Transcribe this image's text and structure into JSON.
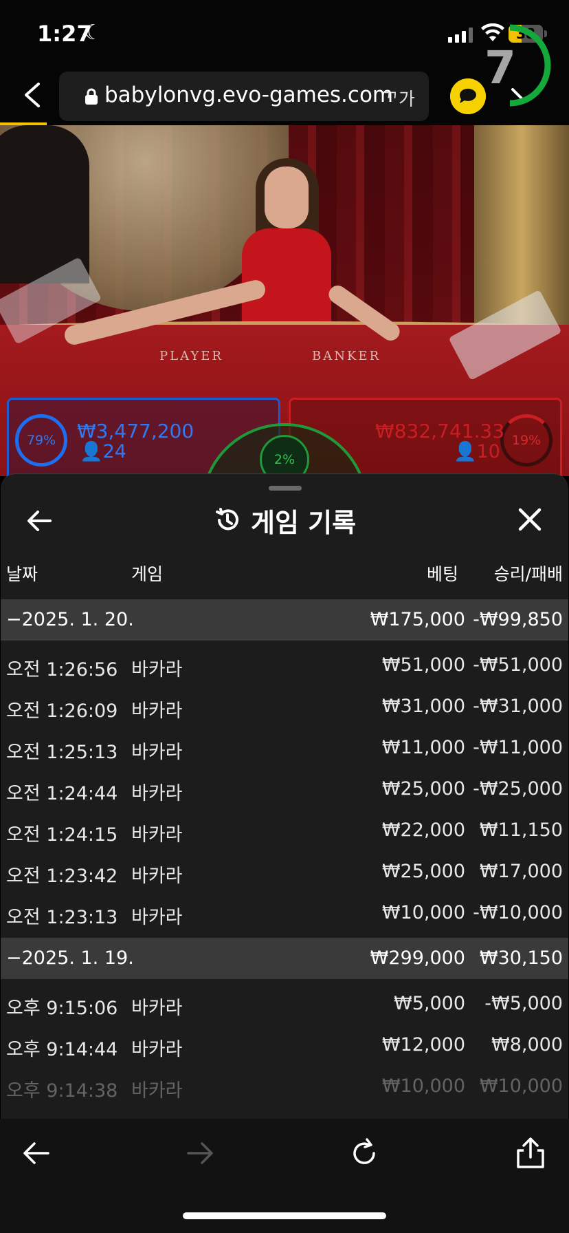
{
  "status_bar": {
    "time": "1:27",
    "moon_icon": "moon-icon",
    "battery": "38",
    "battery_color": "#f2c200"
  },
  "browser": {
    "url": "babylonvg.evo-games.com",
    "text_size_button": "ᄁ가",
    "accent_color": "#f2c200"
  },
  "game": {
    "timer": "7",
    "table_labels": {
      "player": "PLAYER",
      "banker": "BANKER"
    },
    "player": {
      "percent": "79%",
      "amount": "₩3,477,200",
      "count": "24",
      "color": "#2e7af5"
    },
    "banker": {
      "percent": "19%",
      "amount": "₩832,741.33",
      "count": "10",
      "color": "#c81e24"
    },
    "tie": {
      "percent": "2%",
      "color": "#2fc24f"
    }
  },
  "history": {
    "title": "게임 기록",
    "columns": {
      "date": "날짜",
      "game": "게임",
      "bet": "베팅",
      "result": "승리/패배"
    },
    "groups": [
      {
        "date": "−2025. 1. 20.",
        "bet": "₩175,000",
        "result": "-₩99,850",
        "rows": [
          {
            "time": "오전 1:26:56",
            "game": "바카라",
            "bet": "₩51,000",
            "result": "-₩51,000"
          },
          {
            "time": "오전 1:26:09",
            "game": "바카라",
            "bet": "₩31,000",
            "result": "-₩31,000"
          },
          {
            "time": "오전 1:25:13",
            "game": "바카라",
            "bet": "₩11,000",
            "result": "-₩11,000"
          },
          {
            "time": "오전 1:24:44",
            "game": "바카라",
            "bet": "₩25,000",
            "result": "-₩25,000"
          },
          {
            "time": "오전 1:24:15",
            "game": "바카라",
            "bet": "₩22,000",
            "result": "₩11,150"
          },
          {
            "time": "오전 1:23:42",
            "game": "바카라",
            "bet": "₩25,000",
            "result": "₩17,000"
          },
          {
            "time": "오전 1:23:13",
            "game": "바카라",
            "bet": "₩10,000",
            "result": "-₩10,000"
          }
        ]
      },
      {
        "date": "−2025. 1. 19.",
        "bet": "₩299,000",
        "result": "₩30,150",
        "rows": [
          {
            "time": "오후 9:15:06",
            "game": "바카라",
            "bet": "₩5,000",
            "result": "-₩5,000"
          },
          {
            "time": "오후 9:14:44",
            "game": "바카라",
            "bet": "₩12,000",
            "result": "₩8,000"
          },
          {
            "time": "오후 9:14:38",
            "game": "바카라",
            "bet": "₩10,000",
            "result": "₩10,000"
          }
        ]
      }
    ]
  }
}
